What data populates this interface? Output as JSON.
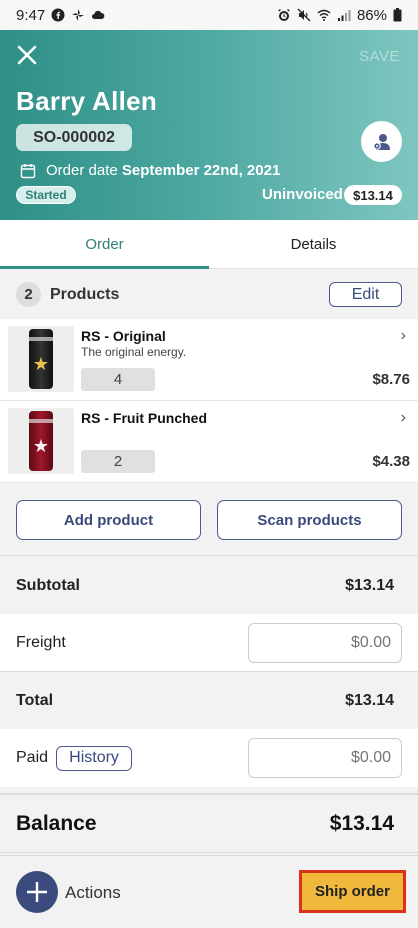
{
  "status_bar": {
    "time": "9:47",
    "battery": "86%"
  },
  "header": {
    "save_label": "SAVE",
    "customer_name": "Barry Allen",
    "order_number": "SO-000002",
    "order_date_label": "Order date",
    "order_date_value": "September 22nd, 2021",
    "status": "Started",
    "invoice_status": "Uninvoiced",
    "total": "$13.14"
  },
  "tabs": [
    {
      "label": "Order",
      "active": true
    },
    {
      "label": "Details",
      "active": false
    }
  ],
  "products": {
    "count": "2",
    "title": "Products",
    "edit_label": "Edit",
    "items": [
      {
        "name": "RS - Original",
        "description": "The original energy.",
        "quantity": "4",
        "price": "$8.76"
      },
      {
        "name": "RS - Fruit Punched",
        "description": "",
        "quantity": "2",
        "price": "$4.38"
      }
    ]
  },
  "actions": {
    "add_product": "Add product",
    "scan_products": "Scan products"
  },
  "summary": {
    "subtotal_label": "Subtotal",
    "subtotal_value": "$13.14",
    "freight_label": "Freight",
    "freight_placeholder": "$0.00",
    "total_label": "Total",
    "total_value": "$13.14",
    "paid_label": "Paid",
    "history_label": "History",
    "paid_placeholder": "$0.00",
    "balance_label": "Balance",
    "balance_value": "$13.14"
  },
  "bottom_bar": {
    "actions_label": "Actions",
    "ship_label": "Ship order"
  },
  "colors": {
    "header_gradient_start": "#2f8f86",
    "accent": "#3c4b7e",
    "ship_button": "#f0b93c",
    "ship_border": "#d8321f"
  }
}
